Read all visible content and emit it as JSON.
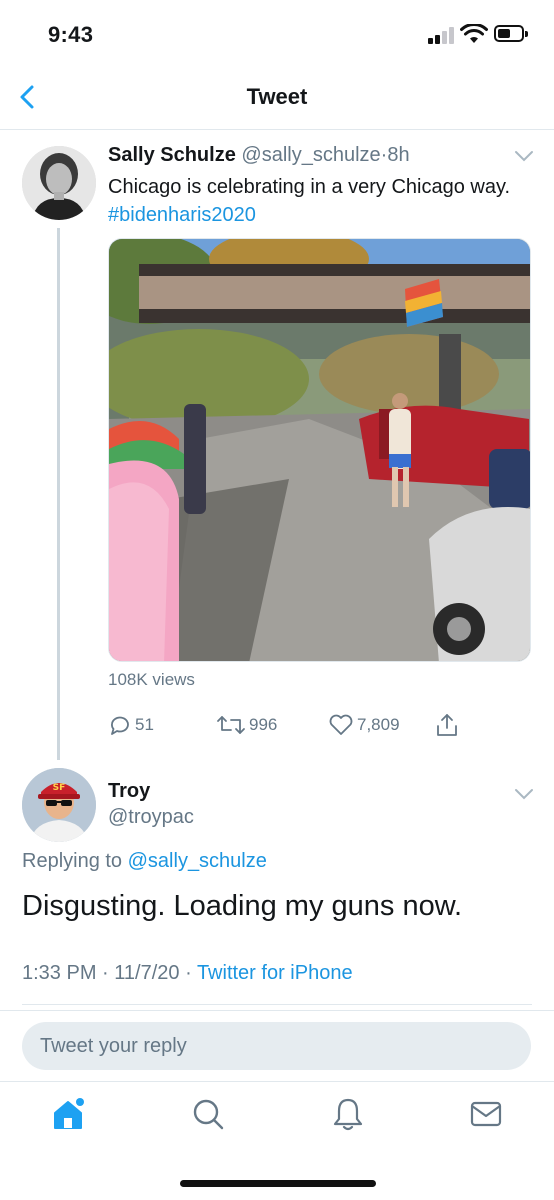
{
  "status_bar": {
    "time": "9:43"
  },
  "nav": {
    "title": "Tweet"
  },
  "tweet": {
    "author_name": "Sally Schulze",
    "author_handle": "@sally_schulze",
    "separator": "·",
    "time_ago": "8h",
    "text": "Chicago is celebrating in a very Chicago way.",
    "hashtag": "#bidenharis2020",
    "views": "108K views",
    "stats": {
      "replies": "51",
      "retweets": "996",
      "likes": "7,809"
    }
  },
  "reply": {
    "author_name": "Troy",
    "author_handle": "@troypac",
    "replying_prefix": "Replying to",
    "replying_to": "@sally_schulze",
    "text": "Disgusting. Loading my guns now.",
    "time": "1:33 PM",
    "date": "11/7/20",
    "source": "Twitter for iPhone"
  },
  "reply_box": {
    "placeholder": "Tweet your reply"
  },
  "colors": {
    "accent": "#1da1f2",
    "link": "#1b95e0",
    "muted": "#657786",
    "divider": "#e1e8ed"
  },
  "tabs": [
    {
      "icon": "home-icon"
    },
    {
      "icon": "search-icon"
    },
    {
      "icon": "bell-icon"
    },
    {
      "icon": "mail-icon"
    }
  ]
}
